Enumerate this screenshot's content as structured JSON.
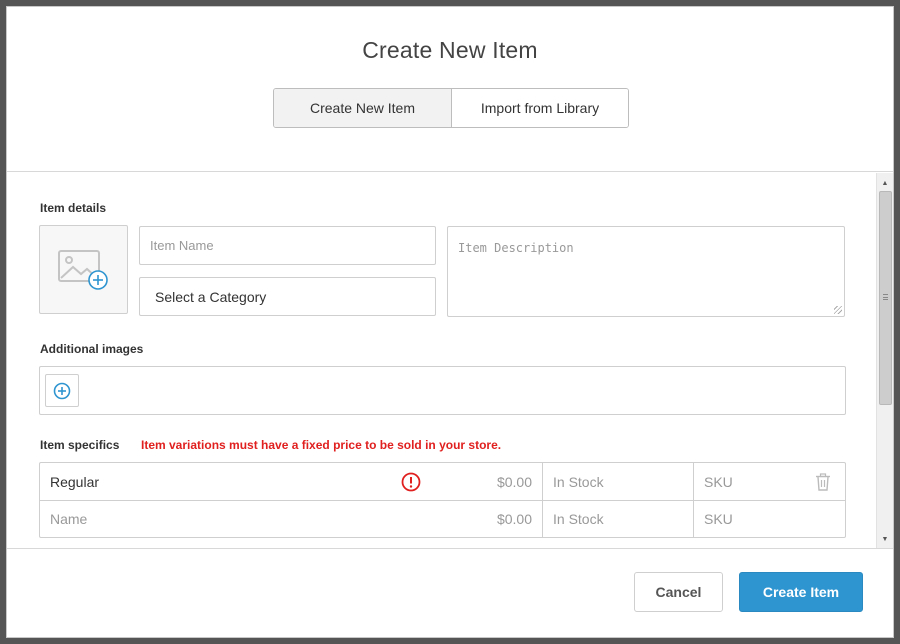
{
  "modal": {
    "title": "Create New Item",
    "tabs": [
      {
        "label": "Create New Item",
        "active": true
      },
      {
        "label": "Import from Library",
        "active": false
      }
    ]
  },
  "item_details": {
    "section_label": "Item details",
    "name_placeholder": "Item Name",
    "category_value": "Select a Category",
    "description_placeholder": "Item Description"
  },
  "additional_images": {
    "section_label": "Additional images"
  },
  "item_specifics": {
    "section_label": "Item specifics",
    "warning": "Item variations must have a fixed price to be sold in your store.",
    "rows": [
      {
        "name": "Regular",
        "price": "$0.00",
        "stock": "In Stock",
        "sku": "SKU"
      },
      {
        "name": "Name",
        "price": "$0.00",
        "stock": "In Stock",
        "sku": "SKU"
      }
    ]
  },
  "footer": {
    "cancel_label": "Cancel",
    "create_label": "Create Item"
  },
  "colors": {
    "accent": "#2f95d0",
    "warning": "#e0201f"
  }
}
